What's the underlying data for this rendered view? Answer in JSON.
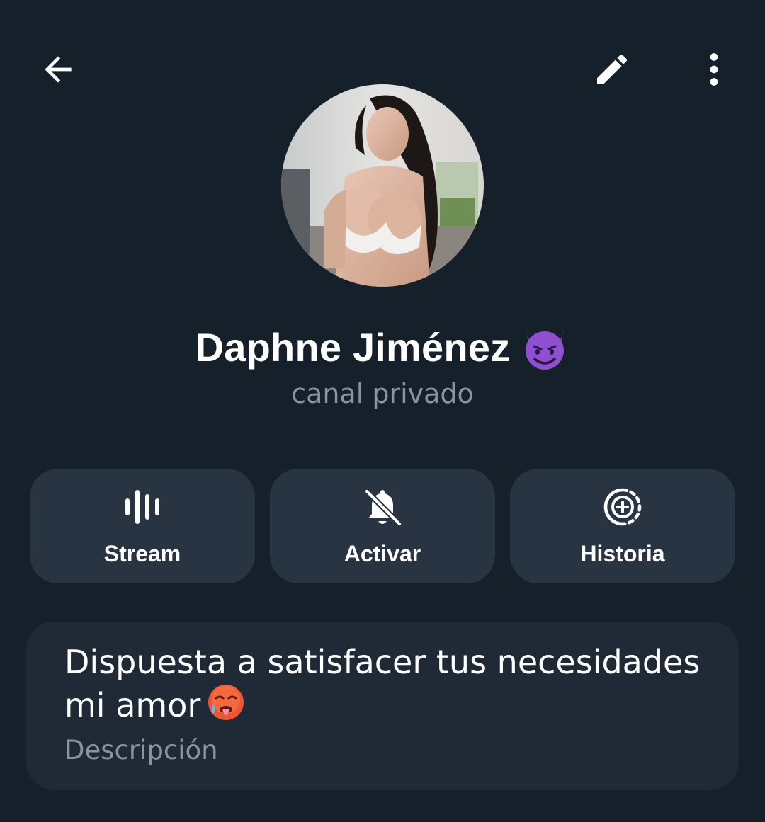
{
  "header": {
    "back_icon": "arrow-left-icon",
    "edit_icon": "pencil-icon",
    "menu_icon": "vertical-dots-icon"
  },
  "profile": {
    "avatar": "profile-photo",
    "name": "Daphne Jiménez",
    "name_emoji": "smiling-devil-emoji",
    "subtitle": "canal privado"
  },
  "actions": [
    {
      "label": "Stream",
      "icon": "live-stream-icon"
    },
    {
      "label": "Activar",
      "icon": "bell-off-icon"
    },
    {
      "label": "Historia",
      "icon": "add-story-icon"
    }
  ],
  "info": {
    "bio_line1": "Dispuesta a satisfacer tus necesidades",
    "bio_line2": "mi amor",
    "bio_emoji": "hot-face-emoji",
    "bio_label": "Descripción"
  },
  "colors": {
    "background": "#16202b",
    "button_bg": "#283442",
    "card_bg": "#1f2a36",
    "secondary_text": "#8795a3",
    "emoji_purple": "#8e4fd0"
  }
}
